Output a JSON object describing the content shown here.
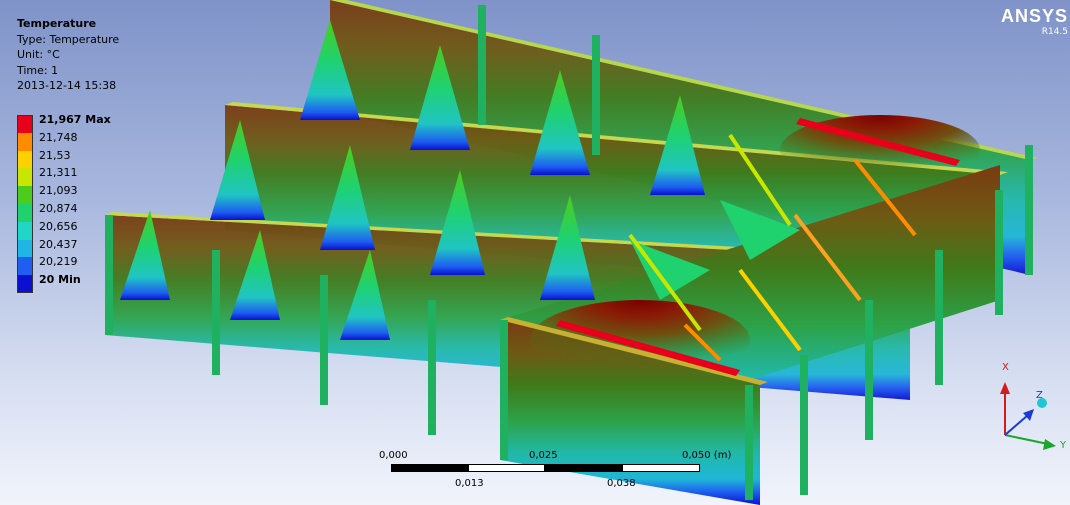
{
  "result_info": {
    "title": "Temperature",
    "type": "Type: Temperature",
    "unit": "Unit: °C",
    "time": "Time: 1",
    "timestamp": "2013-12-14 15:38"
  },
  "legend": {
    "items": [
      {
        "label": "21,967 Max",
        "color": "#e8001a"
      },
      {
        "label": "21,748",
        "color": "#ff8c00"
      },
      {
        "label": "21,53",
        "color": "#ffd000"
      },
      {
        "label": "21,311",
        "color": "#c8e600"
      },
      {
        "label": "21,093",
        "color": "#4ccc1c"
      },
      {
        "label": "20,874",
        "color": "#1fd26e"
      },
      {
        "label": "20,656",
        "color": "#20d6c4"
      },
      {
        "label": "20,437",
        "color": "#1fb6e6"
      },
      {
        "label": "20,219",
        "color": "#1e5ef0"
      },
      {
        "label": "20 Min",
        "color": "#0a0fd0"
      }
    ]
  },
  "brand": {
    "name": "ANSYS",
    "version": "R14.5"
  },
  "scale_bar": {
    "labels_top": [
      "0,000",
      "0,025",
      "0,050 (m)"
    ],
    "labels_bottom": [
      "0,013",
      "0,038"
    ]
  },
  "triad": {
    "x_label": "X",
    "y_label": "Y",
    "z_label": "Z"
  }
}
